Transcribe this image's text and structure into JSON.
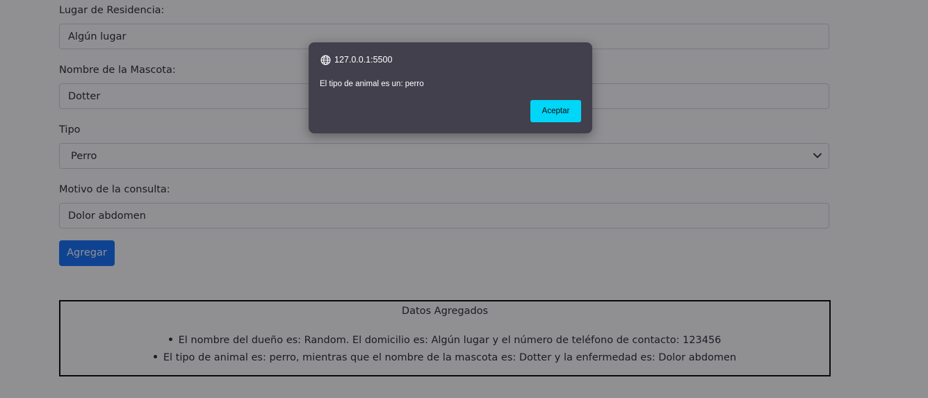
{
  "form": {
    "residence_label": "Lugar de Residencia:",
    "residence_value": "Algún lugar",
    "pet_name_label": "Nombre de la Mascota:",
    "pet_name_value": "Dotter",
    "type_label": "Tipo",
    "type_selected": "Perro",
    "reason_label": "Motivo de la consulta:",
    "reason_value": "Dolor abdomen",
    "submit_label": "Agregar"
  },
  "results": {
    "title": "Datos Agregados",
    "items": [
      "El nombre del dueño es: Random. El domicilio es: Algún lugar y el número de teléfono de contacto: 123456",
      "El tipo de animal es: perro, mientras que el nombre de la mascota es: Dotter y la enfermedad es: Dolor abdomen"
    ]
  },
  "alert": {
    "origin": "127.0.0.1:5500",
    "origin_icon": "globe-icon",
    "message": "El tipo de animal es un: perro",
    "accept_label": "Aceptar"
  },
  "colors": {
    "primary_button": "#0d6efd",
    "dialog_background": "#42404d",
    "accept_button": "#00d6f7"
  }
}
